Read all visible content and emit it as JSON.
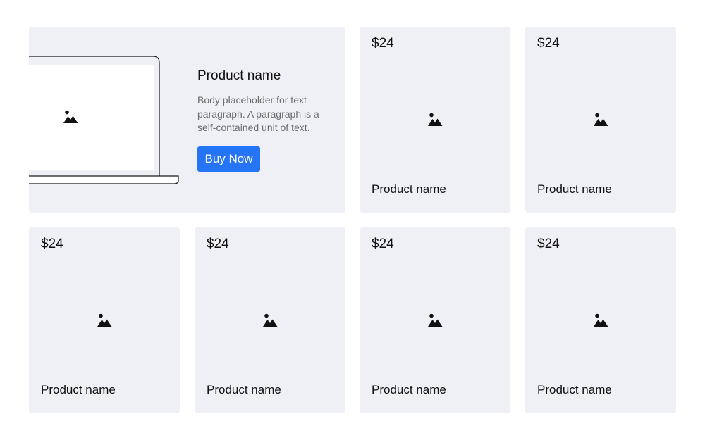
{
  "featured": {
    "title": "Product name",
    "body": "Body placeholder for text paragraph. A paragraph is a self-contained unit of text.",
    "button_label": "Buy Now",
    "image_icon": "image-placeholder-icon",
    "device_icon": "laptop-icon"
  },
  "products": [
    {
      "price": "$24",
      "name": "Product name",
      "image_icon": "image-placeholder-icon"
    },
    {
      "price": "$24",
      "name": "Product name",
      "image_icon": "image-placeholder-icon"
    },
    {
      "price": "$24",
      "name": "Product name",
      "image_icon": "image-placeholder-icon"
    },
    {
      "price": "$24",
      "name": "Product name",
      "image_icon": "image-placeholder-icon"
    },
    {
      "price": "$24",
      "name": "Product name",
      "image_icon": "image-placeholder-icon"
    },
    {
      "price": "$24",
      "name": "Product name",
      "image_icon": "image-placeholder-icon"
    }
  ],
  "colors": {
    "card_background": "#eff0f5",
    "accent": "#2574f5",
    "body_text": "#6b6b70"
  }
}
